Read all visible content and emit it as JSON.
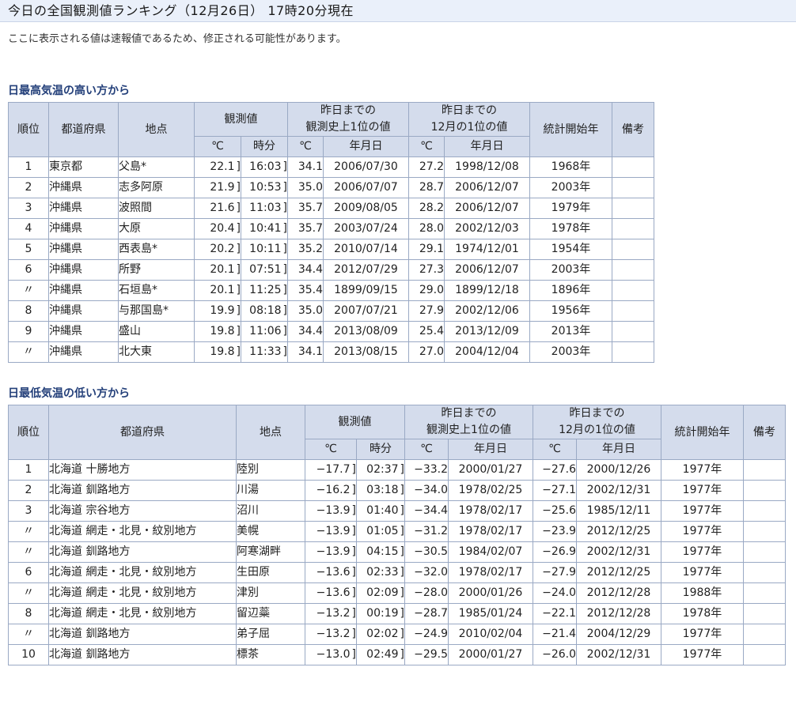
{
  "page": {
    "title": "今日の全国観測値ランキング（12月26日） 17時20分現在",
    "notice": "ここに表示される値は速報値であるため、修正される可能性があります。"
  },
  "headers": {
    "rank": "順位",
    "pref": "都道府県",
    "point": "地点",
    "obs": "観測値",
    "hist_l1": "昨日までの",
    "hist_l2": "観測史上1位の値",
    "month_l1": "昨日までの",
    "month_l2": "12月の1位の値",
    "start": "統計開始年",
    "note": "備考",
    "unit": "℃",
    "time": "時分",
    "date": "年月日"
  },
  "sections": [
    {
      "heading": "日最高気温の高い方から",
      "rows": [
        {
          "rank": "1",
          "pref": "東京都",
          "point": "父島*",
          "value": "22.1",
          "qv": "]",
          "time": "16:03",
          "qt": "]",
          "hist_val": "34.1",
          "hist_date": "2006/07/30",
          "month_val": "27.2",
          "month_date": "1998/12/08",
          "start": "1968年",
          "note": ""
        },
        {
          "rank": "2",
          "pref": "沖縄県",
          "point": "志多阿原",
          "value": "21.9",
          "qv": "]",
          "time": "10:53",
          "qt": "]",
          "hist_val": "35.0",
          "hist_date": "2006/07/07",
          "month_val": "28.7",
          "month_date": "2006/12/07",
          "start": "2003年",
          "note": ""
        },
        {
          "rank": "3",
          "pref": "沖縄県",
          "point": "波照間",
          "value": "21.6",
          "qv": "]",
          "time": "11:03",
          "qt": "]",
          "hist_val": "35.7",
          "hist_date": "2009/08/05",
          "month_val": "28.2",
          "month_date": "2006/12/07",
          "start": "1979年",
          "note": ""
        },
        {
          "rank": "4",
          "pref": "沖縄県",
          "point": "大原",
          "value": "20.4",
          "qv": "]",
          "time": "10:41",
          "qt": "]",
          "hist_val": "35.7",
          "hist_date": "2003/07/24",
          "month_val": "28.0",
          "month_date": "2002/12/03",
          "start": "1978年",
          "note": ""
        },
        {
          "rank": "5",
          "pref": "沖縄県",
          "point": "西表島*",
          "value": "20.2",
          "qv": "]",
          "time": "10:11",
          "qt": "]",
          "hist_val": "35.2",
          "hist_date": "2010/07/14",
          "month_val": "29.1",
          "month_date": "1974/12/01",
          "start": "1954年",
          "note": ""
        },
        {
          "rank": "6",
          "pref": "沖縄県",
          "point": "所野",
          "value": "20.1",
          "qv": "]",
          "time": "07:51",
          "qt": "]",
          "hist_val": "34.4",
          "hist_date": "2012/07/29",
          "month_val": "27.3",
          "month_date": "2006/12/07",
          "start": "2003年",
          "note": ""
        },
        {
          "rank": "〃",
          "pref": "沖縄県",
          "point": "石垣島*",
          "value": "20.1",
          "qv": "]",
          "time": "11:25",
          "qt": "]",
          "hist_val": "35.4",
          "hist_date": "1899/09/15",
          "month_val": "29.0",
          "month_date": "1899/12/18",
          "start": "1896年",
          "note": ""
        },
        {
          "rank": "8",
          "pref": "沖縄県",
          "point": "与那国島*",
          "value": "19.9",
          "qv": "]",
          "time": "08:18",
          "qt": "]",
          "hist_val": "35.0",
          "hist_date": "2007/07/21",
          "month_val": "27.9",
          "month_date": "2002/12/06",
          "start": "1956年",
          "note": ""
        },
        {
          "rank": "9",
          "pref": "沖縄県",
          "point": "盛山",
          "value": "19.8",
          "qv": "]",
          "time": "11:06",
          "qt": "]",
          "hist_val": "34.4",
          "hist_date": "2013/08/09",
          "month_val": "25.4",
          "month_date": "2013/12/09",
          "start": "2013年",
          "note": ""
        },
        {
          "rank": "〃",
          "pref": "沖縄県",
          "point": "北大東",
          "value": "19.8",
          "qv": "]",
          "time": "11:33",
          "qt": "]",
          "hist_val": "34.1",
          "hist_date": "2013/08/15",
          "month_val": "27.0",
          "month_date": "2004/12/04",
          "start": "2003年",
          "note": ""
        }
      ]
    },
    {
      "heading": "日最低気温の低い方から",
      "rows": [
        {
          "rank": "1",
          "pref": "北海道 十勝地方",
          "point": "陸別",
          "value": "−17.7",
          "qv": "]",
          "time": "02:37",
          "qt": "]",
          "hist_val": "−33.2",
          "hist_date": "2000/01/27",
          "month_val": "−27.6",
          "month_date": "2000/12/26",
          "start": "1977年",
          "note": ""
        },
        {
          "rank": "2",
          "pref": "北海道 釧路地方",
          "point": "川湯",
          "value": "−16.2",
          "qv": "]",
          "time": "03:18",
          "qt": "]",
          "hist_val": "−34.0",
          "hist_date": "1978/02/25",
          "month_val": "−27.1",
          "month_date": "2002/12/31",
          "start": "1977年",
          "note": ""
        },
        {
          "rank": "3",
          "pref": "北海道 宗谷地方",
          "point": "沼川",
          "value": "−13.9",
          "qv": "]",
          "time": "01:40",
          "qt": "]",
          "hist_val": "−34.4",
          "hist_date": "1978/02/17",
          "month_val": "−25.6",
          "month_date": "1985/12/11",
          "start": "1977年",
          "note": ""
        },
        {
          "rank": "〃",
          "pref": "北海道 網走・北見・紋別地方",
          "point": "美幌",
          "value": "−13.9",
          "qv": "]",
          "time": "01:05",
          "qt": "]",
          "hist_val": "−31.2",
          "hist_date": "1978/02/17",
          "month_val": "−23.9",
          "month_date": "2012/12/25",
          "start": "1977年",
          "note": ""
        },
        {
          "rank": "〃",
          "pref": "北海道 釧路地方",
          "point": "阿寒湖畔",
          "value": "−13.9",
          "qv": "]",
          "time": "04:15",
          "qt": "]",
          "hist_val": "−30.5",
          "hist_date": "1984/02/07",
          "month_val": "−26.9",
          "month_date": "2002/12/31",
          "start": "1977年",
          "note": ""
        },
        {
          "rank": "6",
          "pref": "北海道 網走・北見・紋別地方",
          "point": "生田原",
          "value": "−13.6",
          "qv": "]",
          "time": "02:33",
          "qt": "]",
          "hist_val": "−32.0",
          "hist_date": "1978/02/17",
          "month_val": "−27.9",
          "month_date": "2012/12/25",
          "start": "1977年",
          "note": ""
        },
        {
          "rank": "〃",
          "pref": "北海道 網走・北見・紋別地方",
          "point": "津別",
          "value": "−13.6",
          "qv": "]",
          "time": "02:09",
          "qt": "]",
          "hist_val": "−28.0",
          "hist_date": "2000/01/26",
          "month_val": "−24.0",
          "month_date": "2012/12/28",
          "start": "1988年",
          "note": ""
        },
        {
          "rank": "8",
          "pref": "北海道 網走・北見・紋別地方",
          "point": "留辺蘂",
          "value": "−13.2",
          "qv": "]",
          "time": "00:19",
          "qt": "]",
          "hist_val": "−28.7",
          "hist_date": "1985/01/24",
          "month_val": "−22.1",
          "month_date": "2012/12/28",
          "start": "1978年",
          "note": ""
        },
        {
          "rank": "〃",
          "pref": "北海道 釧路地方",
          "point": "弟子屈",
          "value": "−13.2",
          "qv": "]",
          "time": "02:02",
          "qt": "]",
          "hist_val": "−24.9",
          "hist_date": "2010/02/04",
          "month_val": "−21.4",
          "month_date": "2004/12/29",
          "start": "1977年",
          "note": ""
        },
        {
          "rank": "10",
          "pref": "北海道 釧路地方",
          "point": "標茶",
          "value": "−13.0",
          "qv": "]",
          "time": "02:49",
          "qt": "]",
          "hist_val": "−29.5",
          "hist_date": "2000/01/27",
          "month_val": "−26.0",
          "month_date": "2002/12/31",
          "start": "1977年",
          "note": ""
        }
      ]
    }
  ]
}
